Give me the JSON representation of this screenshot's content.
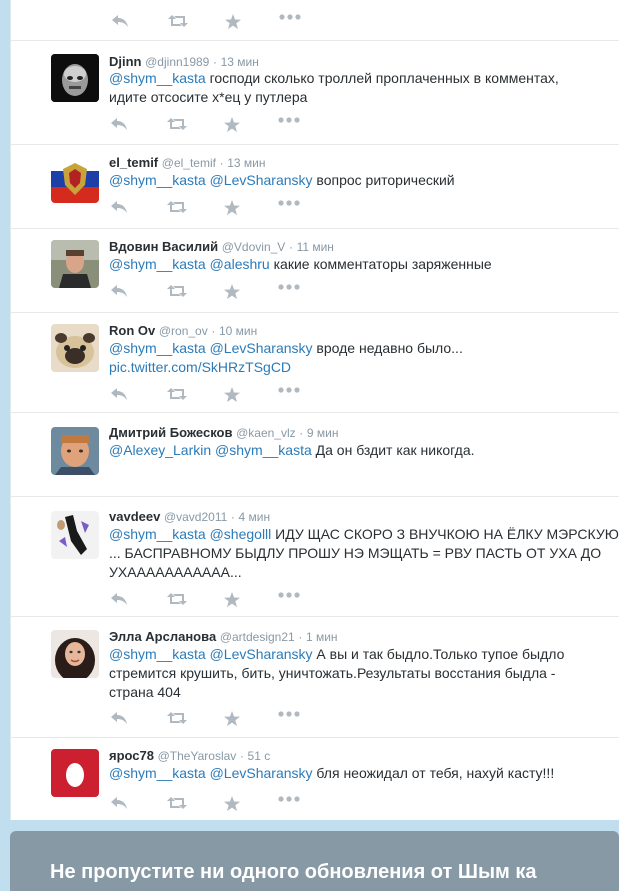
{
  "tweets": [
    {
      "fullname": "Djinn",
      "handle": "@djinn1989",
      "time": "13 мин",
      "dot": "·",
      "segments": [
        {
          "t": "@shym__kasta",
          "m": true
        },
        {
          "t": " господи сколько троллей проплаченных в комментах, идите отсосите х*ец у путлера",
          "m": false
        }
      ]
    },
    {
      "fullname": "el_temif",
      "handle": "@el_temif",
      "time": "13 мин",
      "dot": "·",
      "segments": [
        {
          "t": "@shym__kasta",
          "m": true
        },
        {
          "t": " ",
          "m": false
        },
        {
          "t": "@LevSharansky",
          "m": true
        },
        {
          "t": " вопрос риторический",
          "m": false
        }
      ]
    },
    {
      "fullname": "Вдовин Василий",
      "handle": "@Vdovin_V",
      "time": "11 мин",
      "dot": "·",
      "segments": [
        {
          "t": "@shym__kasta",
          "m": true
        },
        {
          "t": " ",
          "m": false
        },
        {
          "t": "@aleshru",
          "m": true
        },
        {
          "t": " какие комментаторы заряженные",
          "m": false
        }
      ]
    },
    {
      "fullname": "Ron Ov",
      "handle": "@ron_ov",
      "time": "10 мин",
      "dot": "·",
      "segments": [
        {
          "t": "@shym__kasta",
          "m": true
        },
        {
          "t": " ",
          "m": false
        },
        {
          "t": "@LevSharansky",
          "m": true
        },
        {
          "t": " вроде недавно было... ",
          "m": false
        },
        {
          "t": "pic.twitter.com/SkHRzTSgCD",
          "m": true
        }
      ]
    },
    {
      "fullname": "Дмитрий Божесков",
      "handle": "@kaen_vlz",
      "time": "9 мин",
      "dot": "·",
      "segments": [
        {
          "t": "@Alexey_Larkin",
          "m": true
        },
        {
          "t": " ",
          "m": false
        },
        {
          "t": "@shym__kasta",
          "m": true
        },
        {
          "t": " Да он бздит как никогда.",
          "m": false
        }
      ]
    },
    {
      "fullname": "vavdeev",
      "handle": "@vavd2011",
      "time": "4 мин",
      "dot": "·",
      "segments": [
        {
          "t": "@shym__kasta",
          "m": true
        },
        {
          "t": " ",
          "m": false
        },
        {
          "t": "@shegolll",
          "m": true
        },
        {
          "t": " ИДУ ЩАС СКОРО  З ВНУЧКОЮ НА ЁЛКУ МЭРСКУЮ  ... БАСПРАВНОМУ БЫДЛУ ПРОШУ НЭ МЭЩАТЬ = РВУ ПАСТЬ ОТ УХА ДО УХААААААААААА...",
          "m": false
        }
      ]
    },
    {
      "fullname": "Элла Арсланова",
      "handle": "@artdesign21",
      "time": "1 мин",
      "dot": "·",
      "segments": [
        {
          "t": "@shym__kasta",
          "m": true
        },
        {
          "t": " ",
          "m": false
        },
        {
          "t": "@LevSharansky",
          "m": true
        },
        {
          "t": " А вы и так быдло.Только тупое  быдло стремится крушить, бить, уничтожать.Результаты восстания быдла - страна 404",
          "m": false
        }
      ]
    },
    {
      "fullname": "ярос78",
      "handle": "@TheYaroslav",
      "time": "51 с",
      "dot": "·",
      "segments": [
        {
          "t": "@shym__kasta",
          "m": true
        },
        {
          "t": " ",
          "m": false
        },
        {
          "t": "@LevSharansky",
          "m": true
        },
        {
          "t": " бля неожидал от тебя, нахуй касту!!!",
          "m": false
        }
      ]
    }
  ],
  "footer": {
    "text": "Не пропустите ни одного обновления от Шым ка"
  },
  "icons": {
    "reply": "reply-icon",
    "retweet": "retweet-icon",
    "favorite": "star-icon",
    "more": "more-icon"
  },
  "colors": {
    "background": "#c0deed",
    "link": "#2b7bb9",
    "meta": "#8899a6",
    "action": "#b0b8c0"
  }
}
